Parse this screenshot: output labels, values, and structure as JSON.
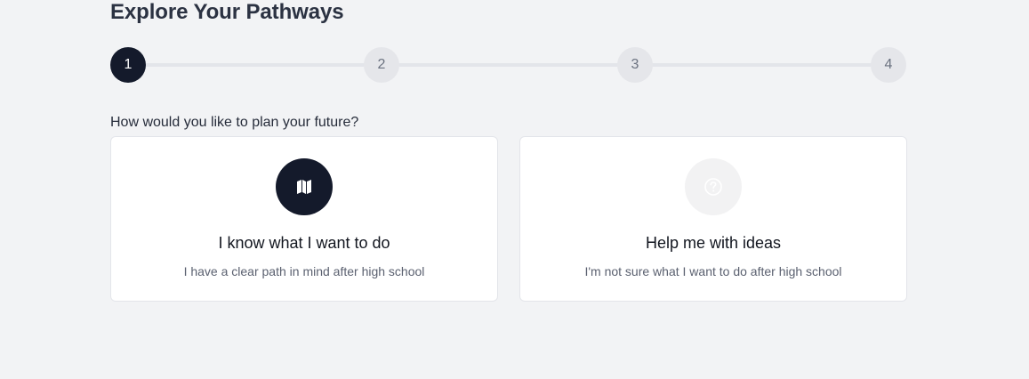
{
  "header": {
    "title": "Explore Your Pathways"
  },
  "stepper": {
    "steps": [
      "1",
      "2",
      "3",
      "4"
    ],
    "current": 1
  },
  "prompt": {
    "question": "How would you like to plan your future?"
  },
  "options": [
    {
      "title": "I know what I want to do",
      "description": "I have a clear path in mind after high school",
      "icon": "map-icon"
    },
    {
      "title": "Help me with ideas",
      "description": "I'm not sure what I want to do after high school",
      "icon": "question-circle-icon"
    }
  ],
  "colors": {
    "background": "#f2f3f5",
    "accent": "#141a2b",
    "inactive_step": "#e5e6ea",
    "card_border": "#e3e5ea"
  }
}
